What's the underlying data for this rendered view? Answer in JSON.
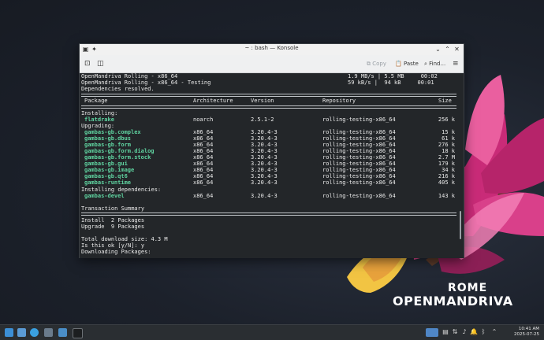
{
  "window": {
    "title": "~ : bash — Konsole",
    "toolbar": {
      "copy_label": "Copy",
      "paste_label": "Paste",
      "find_label": "Find..."
    }
  },
  "terminal": {
    "progress_lines": [
      {
        "left": "OpenMandriva Rolling - x86_64",
        "right": "1.9 MB/s | 5.5 MB     00:02"
      },
      {
        "left": "OpenMandriva Rolling - x86_64 - Testing",
        "right": "59 kB/s |  94 kB     00:01"
      }
    ],
    "deps_resolved": "Dependencies resolved.",
    "headers": {
      "package": "Package",
      "architecture": "Architecture",
      "version": "Version",
      "repository": "Repository",
      "size": "Size"
    },
    "installing_label": "Installing:",
    "installing": [
      {
        "name": "flatdrake",
        "arch": "noarch",
        "version": "2.5.1-2",
        "repo": "rolling-testing-x86_64",
        "size": "256 k"
      }
    ],
    "upgrading_label": "Upgrading:",
    "upgrading": [
      {
        "name": "gambas-gb.complex",
        "arch": "x86_64",
        "version": "3.20.4-3",
        "repo": "rolling-testing-x86_64",
        "size": "15 k"
      },
      {
        "name": "gambas-gb.dbus",
        "arch": "x86_64",
        "version": "3.20.4-3",
        "repo": "rolling-testing-x86_64",
        "size": "61 k"
      },
      {
        "name": "gambas-gb.form",
        "arch": "x86_64",
        "version": "3.20.4-3",
        "repo": "rolling-testing-x86_64",
        "size": "276 k"
      },
      {
        "name": "gambas-gb.form.dialog",
        "arch": "x86_64",
        "version": "3.20.4-3",
        "repo": "rolling-testing-x86_64",
        "size": "18 k"
      },
      {
        "name": "gambas-gb.form.stock",
        "arch": "x86_64",
        "version": "3.20.4-3",
        "repo": "rolling-testing-x86_64",
        "size": "2.7 M"
      },
      {
        "name": "gambas-gb.gui",
        "arch": "x86_64",
        "version": "3.20.4-3",
        "repo": "rolling-testing-x86_64",
        "size": "179 k"
      },
      {
        "name": "gambas-gb.image",
        "arch": "x86_64",
        "version": "3.20.4-3",
        "repo": "rolling-testing-x86_64",
        "size": "34 k"
      },
      {
        "name": "gambas-gb.qt6",
        "arch": "x86_64",
        "version": "3.20.4-3",
        "repo": "rolling-testing-x86_64",
        "size": "216 k"
      },
      {
        "name": "gambas-runtime",
        "arch": "x86_64",
        "version": "3.20.4-3",
        "repo": "rolling-testing-x86_64",
        "size": "405 k"
      }
    ],
    "installing_deps_label": "Installing dependencies:",
    "installing_deps": [
      {
        "name": "gambas-devel",
        "arch": "x86_64",
        "version": "3.20.4-3",
        "repo": "rolling-testing-x86_64",
        "size": "143 k"
      }
    ],
    "summary_label": "Transaction Summary",
    "install_line": "Install  2 Packages",
    "upgrade_line": "Upgrade  9 Packages",
    "total_line": "Total download size: 4.3 M",
    "prompt_line": "Is this ok [y/N]: y",
    "downloading_line": "Downloading Packages:"
  },
  "desktop": {
    "brand_top": "ROME",
    "brand_main": "OPENMANDRIVA"
  },
  "taskbar": {
    "time": "10:41 AM",
    "date": "2025-07-25"
  }
}
